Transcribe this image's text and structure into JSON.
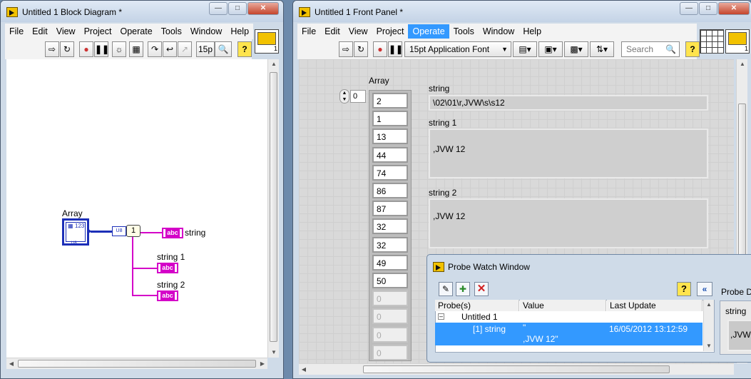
{
  "block_diagram": {
    "title": "Untitled 1 Block Diagram *",
    "menu": [
      "File",
      "Edit",
      "View",
      "Project",
      "Operate",
      "Tools",
      "Window",
      "Help"
    ],
    "font_box": "15p",
    "array_label": "Array",
    "index_constant": "1",
    "u8_tag": "U8",
    "array_icon_text": "123",
    "indicators": [
      {
        "label": "string"
      },
      {
        "label": "string 1"
      },
      {
        "label": "string 2"
      }
    ],
    "terminal_text": "abc"
  },
  "front_panel": {
    "title": "Untitled 1 Front Panel *",
    "menu": [
      "File",
      "Edit",
      "View",
      "Project",
      "Operate",
      "Tools",
      "Window",
      "Help"
    ],
    "active_menu": "Operate",
    "font_dropdown": "15pt Application Font",
    "search_placeholder": "Search",
    "array_label": "Array",
    "array_index": "0",
    "array_values": [
      "2",
      "1",
      "13",
      "44",
      "74",
      "86",
      "87",
      "32",
      "32",
      "49",
      "50"
    ],
    "array_empty": [
      "0",
      "0",
      "0",
      "0"
    ],
    "string_label": "string",
    "string_value": "\\02\\01\\r,JVW\\s\\s12",
    "string1_label": "string 1",
    "string1_value": ",JVW  12",
    "string2_label": "string 2",
    "string2_value": ",JVW  12"
  },
  "probe_window": {
    "title": "Probe Watch Window",
    "columns": [
      "Probe(s)",
      "Value",
      "Last Update"
    ],
    "group": "Untitled 1",
    "row": {
      "probe": "[1] string",
      "value_line1": "\"",
      "value_line2": ",JVW  12\"",
      "last_update": "16/05/2012 13:12:59"
    },
    "side_title": "Probe D",
    "side_label": "string",
    "side_value": ",JVW"
  },
  "colors": {
    "selection": "#3399ff",
    "wire": "#d400c8",
    "array_border": "#1c2fb8"
  }
}
